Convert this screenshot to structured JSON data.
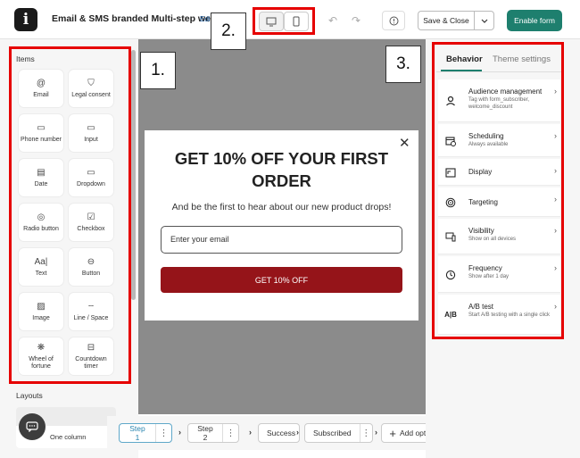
{
  "header": {
    "logo_glyph": "i",
    "title": "Email & SMS branded Multi-step wel...",
    "edit_label": "Edi",
    "save_close_label": "Save & Close",
    "enable_label": "Enable form"
  },
  "callouts": [
    "1.",
    "2.",
    "3."
  ],
  "left_panel": {
    "items_header": "Items",
    "items": [
      {
        "icon": "@",
        "label": "Email",
        "icon_name": "at-icon"
      },
      {
        "icon": "⛉",
        "label": "Legal consent",
        "icon_name": "shield-icon"
      },
      {
        "icon": "▭",
        "label": "Phone number",
        "icon_name": "chat-box-icon"
      },
      {
        "icon": "▭",
        "label": "Input",
        "icon_name": "input-box-icon"
      },
      {
        "icon": "▤",
        "label": "Date",
        "icon_name": "calendar-icon"
      },
      {
        "icon": "▭",
        "label": "Dropdown",
        "icon_name": "dropdown-icon"
      },
      {
        "icon": "◎",
        "label": "Radio button",
        "icon_name": "radio-icon"
      },
      {
        "icon": "☑",
        "label": "Checkbox",
        "icon_name": "checkbox-icon"
      },
      {
        "icon": "Aa|",
        "label": "Text",
        "icon_name": "text-icon"
      },
      {
        "icon": "⊖",
        "label": "Button",
        "icon_name": "button-icon"
      },
      {
        "icon": "▨",
        "label": "Image",
        "icon_name": "image-icon"
      },
      {
        "icon": "┄",
        "label": "Line / Space",
        "icon_name": "line-space-icon"
      },
      {
        "icon": "❋",
        "label": "Wheel of fortune",
        "icon_name": "wheel-icon"
      },
      {
        "icon": "⊟",
        "label": "Countdown timer",
        "icon_name": "countdown-icon"
      }
    ],
    "layouts_header": "Layouts",
    "layout_one_column": "One column"
  },
  "popup": {
    "headline": "GET 10% OFF YOUR FIRST ORDER",
    "subtext": "And be the first to hear about our new product drops!",
    "email_placeholder": "Enter your email",
    "cta_label": "GET 10% OFF",
    "close_glyph": "✕"
  },
  "steps": {
    "items": [
      {
        "label": "Step 1",
        "has_menu": true,
        "active": true
      },
      {
        "label": "Step 2",
        "has_menu": true,
        "active": false
      },
      {
        "label": "Success",
        "has_menu": false,
        "active": false
      },
      {
        "label": "Subscribed",
        "has_menu": true,
        "active": false
      }
    ],
    "add_label": "Add option",
    "menu_glyph": "⋮",
    "arrow_glyph": "›"
  },
  "right_panel": {
    "tabs": [
      "Behavior",
      "Theme settings"
    ],
    "rows": [
      {
        "title": "Audience management",
        "subtitle": "Tag with form_subscriber, welcome_discount",
        "icon": "person-icon"
      },
      {
        "title": "Scheduling",
        "subtitle": "Always available",
        "icon": "calendar-clock-icon"
      },
      {
        "title": "Display",
        "subtitle": "",
        "icon": "display-icon"
      },
      {
        "title": "Targeting",
        "subtitle": "",
        "icon": "target-icon"
      },
      {
        "title": "Visibility",
        "subtitle": "Show on all devices",
        "icon": "devices-icon"
      },
      {
        "title": "Frequency",
        "subtitle": "Show after 1 day",
        "icon": "history-icon"
      },
      {
        "title": "A/B test",
        "subtitle": "Start A/B testing with a single click",
        "icon": "ab-test-icon"
      }
    ],
    "chevron_glyph": "›"
  },
  "colors": {
    "accent": "#1e7f6e",
    "cta": "#951419",
    "callout": "#e60000",
    "canvas": "#8b8b8b"
  }
}
